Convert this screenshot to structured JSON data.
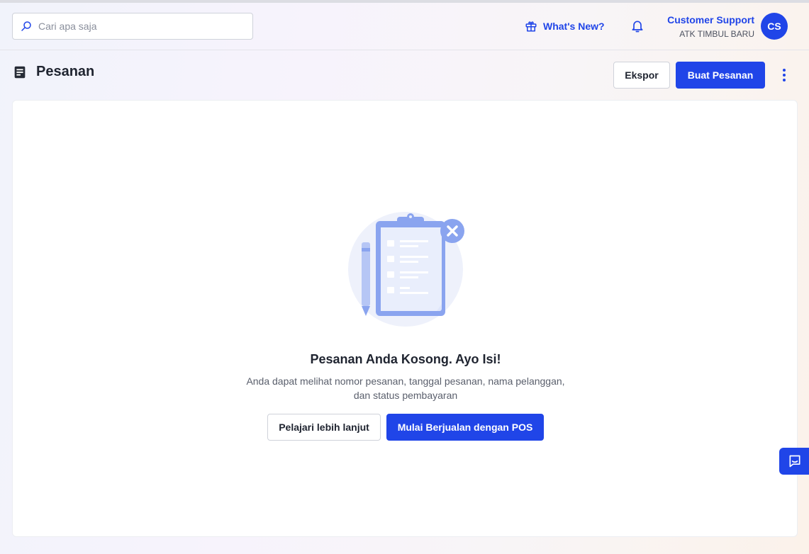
{
  "search": {
    "placeholder": "Cari apa saja"
  },
  "header": {
    "whats_new_label": "What's New?",
    "user_name": "Customer Support",
    "store_name": "ATK TIMBUL BARU",
    "avatar_initials": "CS"
  },
  "page": {
    "title": "Pesanan",
    "export_label": "Ekspor",
    "create_label": "Buat Pesanan"
  },
  "empty_state": {
    "title": "Pesanan Anda Kosong. Ayo Isi!",
    "description_line1": "Anda dapat melihat nomor pesanan, tanggal pesanan, nama pelanggan,",
    "description_line2": "dan status pembayaran",
    "learn_more_label": "Pelajari lebih lanjut",
    "start_pos_label": "Mulai Berjualan dengan POS"
  },
  "icons": {
    "search": "search-icon",
    "gift": "gift-icon",
    "bell": "bell-icon",
    "orders": "receipt-icon",
    "more": "more-vertical-icon",
    "chat": "chat-icon",
    "illustration": "empty-clipboard-illustration"
  },
  "colors": {
    "primary": "#2045e8",
    "text": "#1f2430",
    "muted": "#5a5f6c"
  }
}
